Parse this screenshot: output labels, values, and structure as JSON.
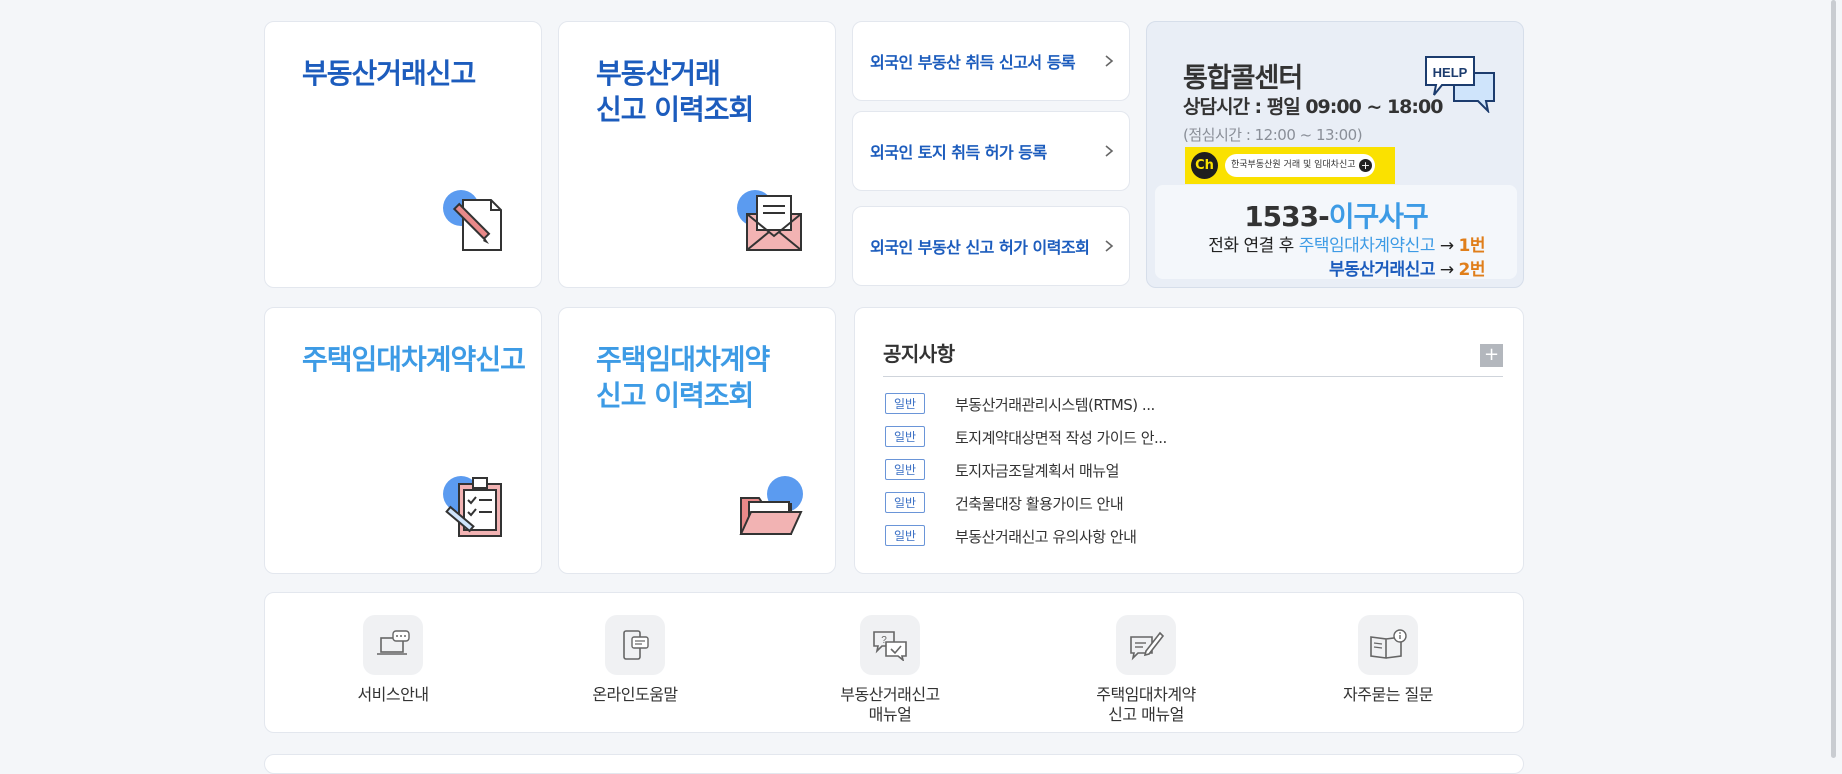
{
  "cards": {
    "realestate_report": "부동산거래신고",
    "realestate_history": "부동산거래\n신고 이력조회",
    "lease_report": "주택임대차계약신고",
    "lease_history": "주택임대차계약\n신고 이력조회"
  },
  "links": [
    "외국인 부동산 취득 신고서 등록",
    "외국인 토지 취득 허가 등록",
    "외국인 부동산 신고 허가 이력조회"
  ],
  "callcenter": {
    "title": "통합콜센터",
    "hours": "상담시간 : 평일 09:00 ~ 18:00",
    "lunch": "(점심시간 : 12:00 ~ 13:00)",
    "kakao_ch": "Ch",
    "kakao_text": "한국부동산원 거래 및 임대차신고",
    "help_text": "HELP",
    "phone_num": "1533-",
    "phone_word": "이구사구",
    "line1_prefix": "전화 연결 후 ",
    "line1_target": "주택임대차계약신고",
    "line1_arrow": " → ",
    "line1_num": "1번",
    "line2_target": "부동산거래신고",
    "line2_arrow": " → ",
    "line2_num": "2번"
  },
  "notice": {
    "title": "공지사항",
    "more": "+",
    "items": [
      {
        "badge": "일반",
        "text": "부동산거래관리시스템(RTMS) ..."
      },
      {
        "badge": "일반",
        "text": "토지계약대상면적 작성 가이드 안..."
      },
      {
        "badge": "일반",
        "text": "토지자금조달계획서 매뉴얼"
      },
      {
        "badge": "일반",
        "text": "건축물대장 활용가이드 안내"
      },
      {
        "badge": "일반",
        "text": "부동산거래신고 유의사항 안내"
      }
    ]
  },
  "quick": [
    {
      "label": "서비스안내",
      "icon": "laptop-chat-icon"
    },
    {
      "label": "온라인도움말",
      "icon": "mobile-chat-icon"
    },
    {
      "label": "부동산거래신고\n매뉴얼",
      "icon": "question-chat-icon"
    },
    {
      "label": "주택임대차계약\n신고 매뉴얼",
      "icon": "pen-document-icon"
    },
    {
      "label": "자주묻는 질문",
      "icon": "book-info-icon"
    }
  ],
  "colors": {
    "primary_blue": "#1c5cbd",
    "sky_blue": "#3d9be5",
    "orange": "#e07e1a",
    "kakao_yellow": "#fae100"
  }
}
